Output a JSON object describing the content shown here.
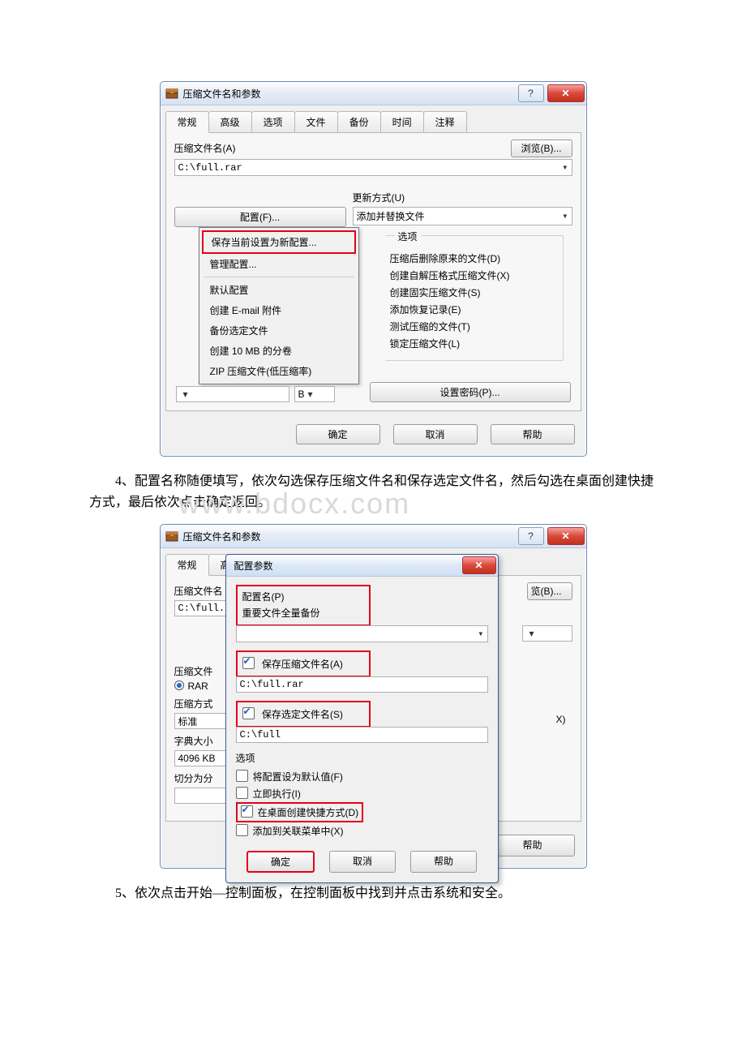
{
  "watermark": "www.bdocx.com",
  "paragraph4": "4、配置名称随便填写，依次勾选保存压缩文件名和保存选定文件名，然后勾选在桌面创建快捷方式，最后依次点击确定返回。",
  "paragraph5": "5、依次点击开始—控制面板，在控制面板中找到并点击系统和安全。",
  "dialog": {
    "title": "压缩文件名和参数",
    "tabs": [
      "常规",
      "高级",
      "选项",
      "文件",
      "备份",
      "时间",
      "注释"
    ],
    "archive_name_label": "压缩文件名(A)",
    "browse_btn": "浏览(B)...",
    "archive_name_value": "C:\\full.rar",
    "profile_btn": "配置(F)...",
    "update_mode_label": "更新方式(U)",
    "update_mode_value": "添加并替换文件",
    "options_label": "选项",
    "options": {
      "del_after": "压缩后删除原来的文件(D)",
      "sfx": "创建自解压格式压缩文件(X)",
      "solid": "创建固实压缩文件(S)",
      "recovery": "添加恢复记录(E)",
      "test": "测试压缩的文件(T)",
      "lock": "锁定压缩文件(L)"
    },
    "size_unit": "B",
    "set_password_btn": "设置密码(P)...",
    "ok": "确定",
    "cancel": "取消",
    "help": "帮助",
    "menu": {
      "save_as_new": "保存当前设置为新配置...",
      "manage": "管理配置...",
      "default": "默认配置",
      "email": "创建 E-mail 附件",
      "backup_sel": "备份选定文件",
      "vol10": "创建 10 MB 的分卷",
      "zip_low": "ZIP 压缩文件(低压缩率)"
    }
  },
  "dialog2": {
    "tabs_partial": [
      "常规",
      "高"
    ],
    "archive_name_label_cut": "压缩文件名",
    "archive_name_value_cut": "C:\\full.",
    "format_label": "压缩文件",
    "format_value": "RAR",
    "method_label": "压缩方式",
    "method_value": "标准",
    "dict_label": "字典大小",
    "dict_value": "4096 KB",
    "split_label": "切分为分",
    "browse_cut": "览(B)...",
    "opt_x_cut": "X)"
  },
  "modal": {
    "title": "配置参数",
    "profile_name_label": "配置名(P)",
    "profile_name_value": "重要文件全量备份",
    "save_archive_name": "保存压缩文件名(A)",
    "save_archive_name_value": "C:\\full.rar",
    "save_selected": "保存选定文件名(S)",
    "save_selected_value": "C:\\full",
    "options_label": "选项",
    "set_default": "将配置设为默认值(F)",
    "run_now": "立即执行(I)",
    "desktop_shortcut": "在桌面创建快捷方式(D)",
    "add_context": "添加到关联菜单中(X)",
    "ok": "确定",
    "cancel": "取消",
    "help": "帮助"
  }
}
